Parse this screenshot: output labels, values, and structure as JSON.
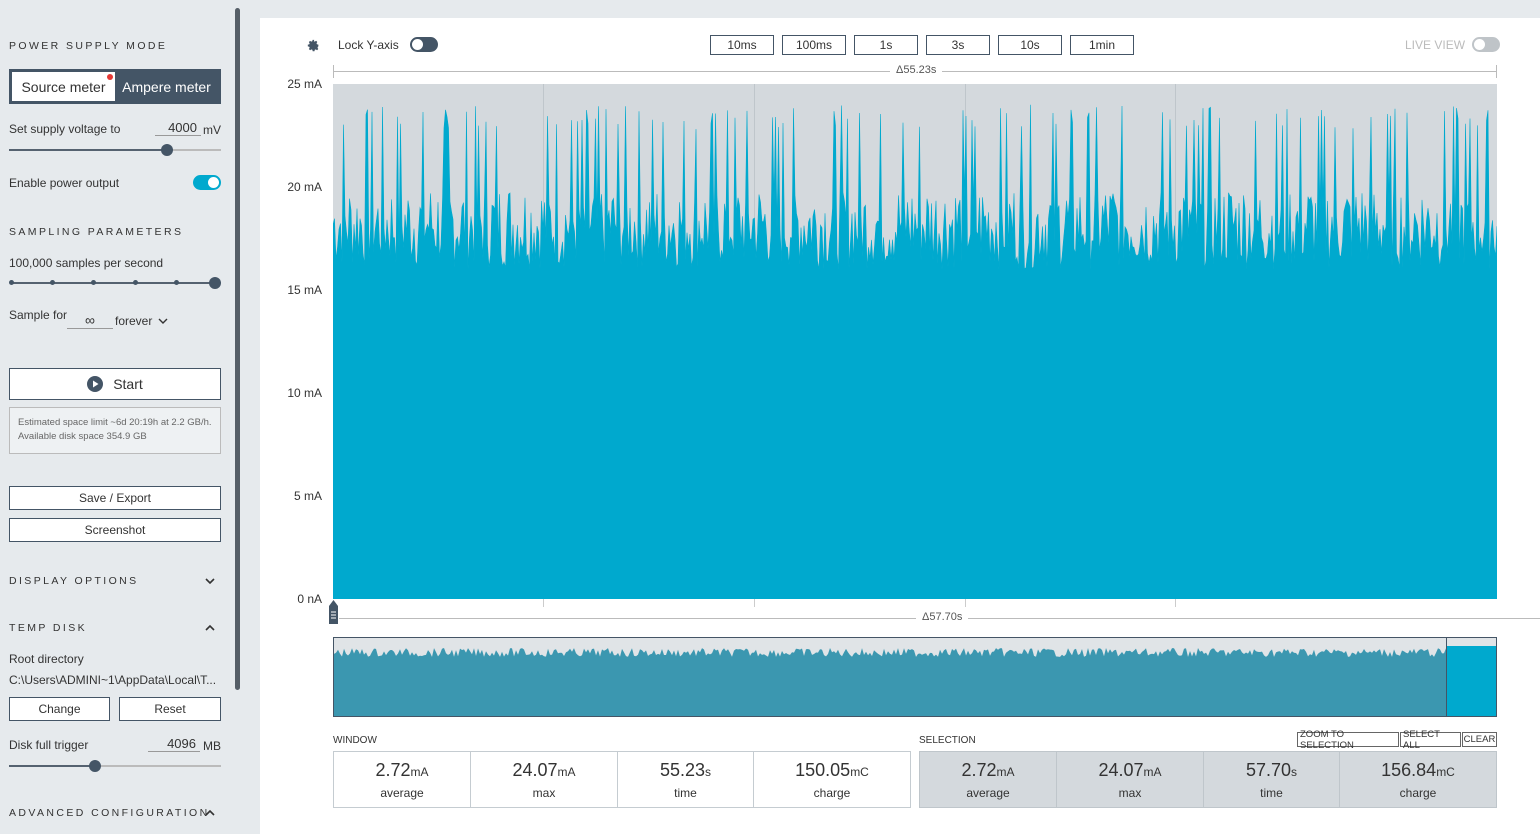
{
  "sidebar": {
    "power_supply_mode": "POWER SUPPLY MODE",
    "source_meter": "Source meter",
    "ampere_meter": "Ampere meter",
    "set_voltage_label": "Set supply voltage to",
    "voltage_value": "4000",
    "voltage_unit": "mV",
    "enable_power": "Enable power output",
    "sampling_parameters": "SAMPLING PARAMETERS",
    "samples_per_second": "100,000 samples per second",
    "sample_for_label": "Sample for",
    "sample_for_value": "∞",
    "sample_for_unit": "forever",
    "start_label": "Start",
    "info_text": "Estimated space limit ~6d 20:19h at 2.2 GB/h. Available disk space 354.9 GB",
    "save_export": "Save / Export",
    "screenshot": "Screenshot",
    "display_options": "DISPLAY OPTIONS",
    "temp_disk": "TEMP DISK",
    "root_directory_label": "Root directory",
    "root_directory_value": "C:\\Users\\ADMINI~1\\AppData\\Local\\T...",
    "change": "Change",
    "reset": "Reset",
    "disk_full_trigger": "Disk full trigger",
    "disk_full_value": "4096",
    "disk_full_unit": "MB",
    "advanced_configuration": "ADVANCED CONFIGURATION"
  },
  "toolbar": {
    "lock_y_axis": "Lock Y-axis",
    "live_view": "LIVE VIEW",
    "window_buttons": [
      "10ms",
      "100ms",
      "1s",
      "3s",
      "10s",
      "1min"
    ]
  },
  "chart": {
    "y_ticks": [
      "25 mA",
      "20 mA",
      "15 mA",
      "10 mA",
      "5 mA",
      "0 nA"
    ],
    "top_delta": "Δ55.23s",
    "bottom_delta": "Δ57.70s",
    "series_color": "#00a9ce"
  },
  "chart_data": {
    "type": "area",
    "xlabel": "",
    "ylabel": "",
    "ylim": [
      0,
      25
    ],
    "y_unit": "mA",
    "y_ticks": [
      0,
      5,
      10,
      15,
      20,
      25
    ],
    "envelope": {
      "min_peak": 16,
      "max_peak": 24,
      "base": 0
    }
  },
  "window_stats": {
    "title": "WINDOW",
    "items": [
      {
        "value": "2.72",
        "unit": "mA",
        "label": "average"
      },
      {
        "value": "24.07",
        "unit": "mA",
        "label": "max"
      },
      {
        "value": "55.23",
        "unit": "s",
        "label": "time"
      },
      {
        "value": "150.05",
        "unit": "mC",
        "label": "charge"
      }
    ]
  },
  "selection_stats": {
    "title": "SELECTION",
    "zoom_to_selection": "ZOOM TO SELECTION",
    "select_all": "SELECT ALL",
    "clear": "CLEAR",
    "items": [
      {
        "value": "2.72",
        "unit": "mA",
        "label": "average"
      },
      {
        "value": "24.07",
        "unit": "mA",
        "label": "max"
      },
      {
        "value": "57.70",
        "unit": "s",
        "label": "time"
      },
      {
        "value": "156.84",
        "unit": "mC",
        "label": "charge"
      }
    ]
  },
  "colors": {
    "accent": "#00a9ce",
    "dark": "#445566",
    "sidebar_bg": "#e6eaed"
  }
}
